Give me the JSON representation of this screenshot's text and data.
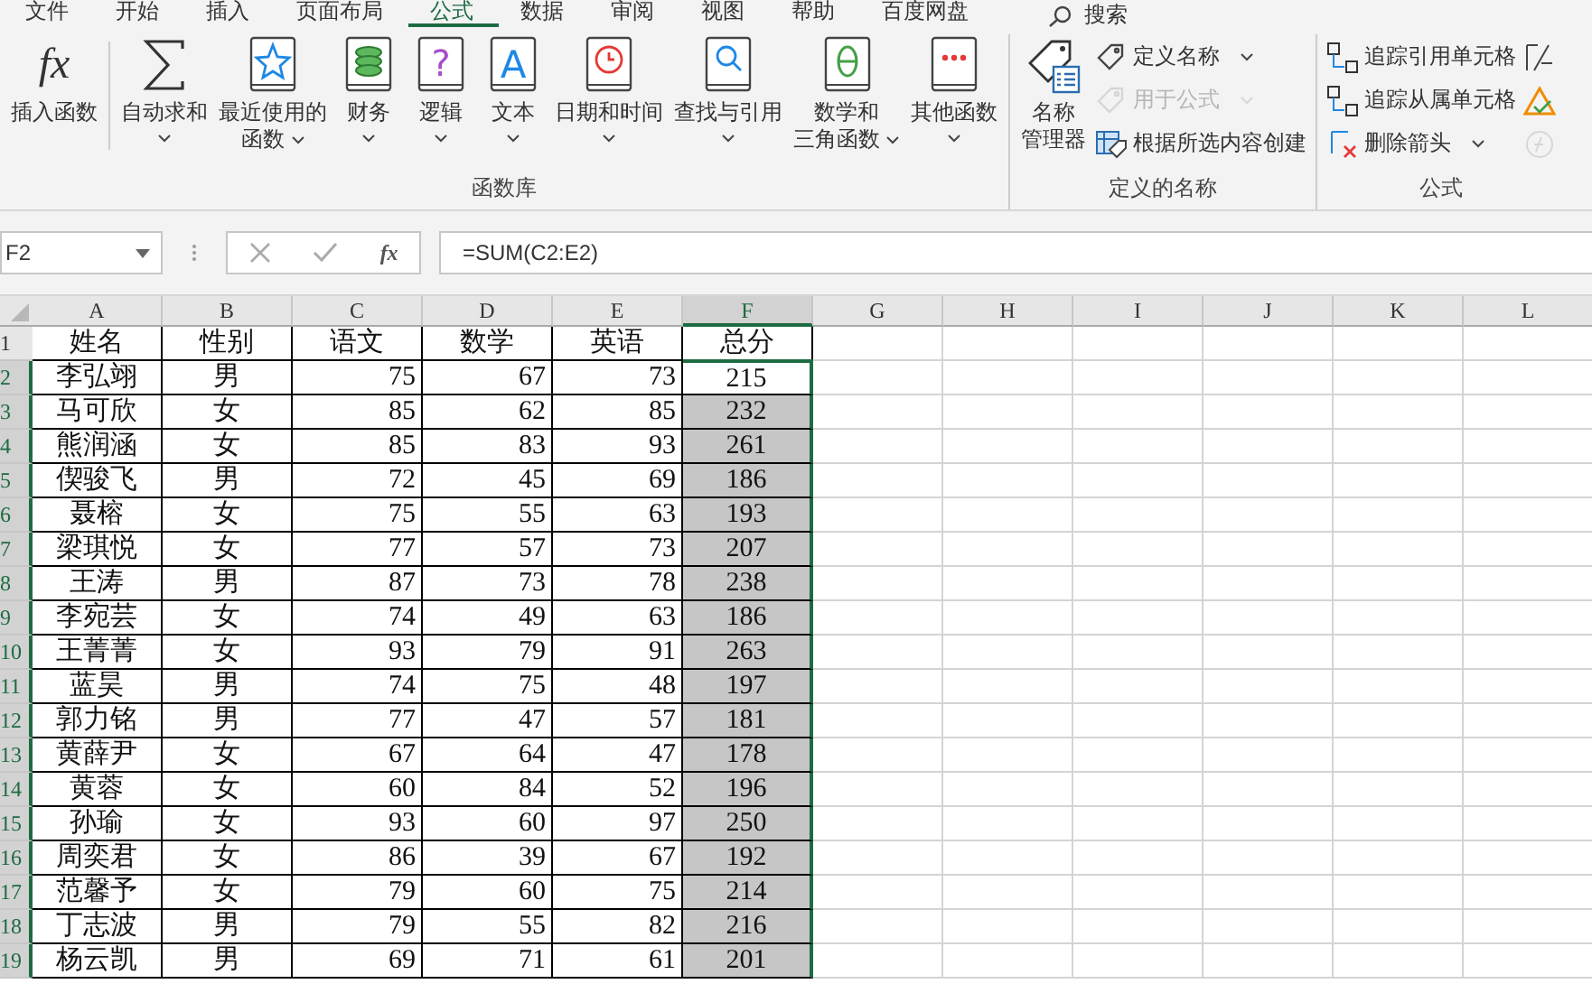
{
  "menu_tabs": [
    {
      "label": "文件",
      "selected": false
    },
    {
      "label": "开始",
      "selected": false
    },
    {
      "label": "插入",
      "selected": false
    },
    {
      "label": "页面布局",
      "selected": false
    },
    {
      "label": "公式",
      "selected": true
    },
    {
      "label": "数据",
      "selected": false
    },
    {
      "label": "审阅",
      "selected": false
    },
    {
      "label": "视图",
      "selected": false
    },
    {
      "label": "帮助",
      "selected": false
    },
    {
      "label": "百度网盘",
      "selected": false
    }
  ],
  "search": {
    "label": "搜索"
  },
  "ribbon": {
    "groups": [
      {
        "label": "函数库",
        "parts": [
          {
            "kind": "big",
            "glyph": "fx",
            "lines": [
              "插入函数"
            ],
            "dropdown": false
          },
          {
            "kind": "big",
            "lines": [
              "自动求和"
            ],
            "dropdown": true
          },
          {
            "kind": "big",
            "lines": [
              "最近使用的",
              "函数"
            ],
            "dropdown": true
          },
          {
            "kind": "big",
            "lines": [
              "财务"
            ],
            "dropdown": true
          },
          {
            "kind": "big",
            "glyph": "?",
            "lines": [
              "逻辑"
            ],
            "dropdown": true
          },
          {
            "kind": "big",
            "glyph": "A",
            "lines": [
              "文本"
            ],
            "dropdown": true
          },
          {
            "kind": "big",
            "lines": [
              "日期和时间"
            ],
            "dropdown": true
          },
          {
            "kind": "big",
            "lines": [
              "查找与引用"
            ],
            "dropdown": true
          },
          {
            "kind": "big",
            "lines": [
              "数学和",
              "三角函数"
            ],
            "dropdown": true
          },
          {
            "kind": "big",
            "lines": [
              "其他函数"
            ],
            "dropdown": true
          }
        ]
      },
      {
        "label": "定义的名称",
        "parts": [
          {
            "kind": "big",
            "lines": [
              "名称",
              "管理器"
            ],
            "dropdown": false
          },
          {
            "kind": "stack",
            "items": [
              {
                "label": "定义名称",
                "dropdown": true,
                "disabled": false
              },
              {
                "label": "用于公式",
                "dropdown": true,
                "disabled": true
              },
              {
                "label": "根据所选内容创建",
                "dropdown": false,
                "disabled": false
              }
            ]
          }
        ]
      },
      {
        "label": "公式",
        "parts": [
          {
            "kind": "stack",
            "items": [
              {
                "label": "追踪引用单元格",
                "dropdown": false,
                "disabled": false
              },
              {
                "label": "追踪从属单元格",
                "dropdown": false,
                "disabled": false
              },
              {
                "label": "删除箭头",
                "dropdown": true,
                "disabled": false
              }
            ]
          },
          {
            "kind": "stack",
            "items": [
              {
                "dropdown": false,
                "disabled": false
              },
              {
                "dropdown": false,
                "disabled": false
              },
              {
                "dropdown": false,
                "disabled": true
              }
            ]
          }
        ]
      }
    ]
  },
  "formula_bar": {
    "name_box": "F2",
    "function_button": "fx",
    "formula": "=SUM(C2:E2)"
  },
  "sheet": {
    "columns": [
      {
        "letter": "A",
        "selected": false
      },
      {
        "letter": "B",
        "selected": false
      },
      {
        "letter": "C",
        "selected": false
      },
      {
        "letter": "D",
        "selected": false
      },
      {
        "letter": "E",
        "selected": false
      },
      {
        "letter": "F",
        "selected": true
      },
      {
        "letter": "G",
        "selected": false
      },
      {
        "letter": "H",
        "selected": false
      },
      {
        "letter": "I",
        "selected": false
      },
      {
        "letter": "J",
        "selected": false
      },
      {
        "letter": "K",
        "selected": false
      },
      {
        "letter": "L",
        "selected": false
      }
    ],
    "rows": [
      {
        "number": "1",
        "selected": false,
        "active": false,
        "cells": [
          "姓名",
          "性别",
          "语文",
          "数学",
          "英语",
          "总分"
        ]
      },
      {
        "number": "2",
        "selected": true,
        "active": true,
        "cells": [
          "李弘翊",
          "男",
          "75",
          "67",
          "73",
          "215"
        ]
      },
      {
        "number": "3",
        "selected": true,
        "active": false,
        "cells": [
          "马可欣",
          "女",
          "85",
          "62",
          "85",
          "232"
        ]
      },
      {
        "number": "4",
        "selected": true,
        "active": false,
        "cells": [
          "熊润涵",
          "女",
          "85",
          "83",
          "93",
          "261"
        ]
      },
      {
        "number": "5",
        "selected": true,
        "active": false,
        "cells": [
          "偰骏飞",
          "男",
          "72",
          "45",
          "69",
          "186"
        ]
      },
      {
        "number": "6",
        "selected": true,
        "active": false,
        "cells": [
          "聂榕",
          "女",
          "75",
          "55",
          "63",
          "193"
        ]
      },
      {
        "number": "7",
        "selected": true,
        "active": false,
        "cells": [
          "梁琪悦",
          "女",
          "77",
          "57",
          "73",
          "207"
        ]
      },
      {
        "number": "8",
        "selected": true,
        "active": false,
        "cells": [
          "王涛",
          "男",
          "87",
          "73",
          "78",
          "238"
        ]
      },
      {
        "number": "9",
        "selected": true,
        "active": false,
        "cells": [
          "李宛芸",
          "女",
          "74",
          "49",
          "63",
          "186"
        ]
      },
      {
        "number": "10",
        "selected": true,
        "active": false,
        "cells": [
          "王菁菁",
          "女",
          "93",
          "79",
          "91",
          "263"
        ]
      },
      {
        "number": "11",
        "selected": true,
        "active": false,
        "cells": [
          "蓝昊",
          "男",
          "74",
          "75",
          "48",
          "197"
        ]
      },
      {
        "number": "12",
        "selected": true,
        "active": false,
        "cells": [
          "郭力铭",
          "男",
          "77",
          "47",
          "57",
          "181"
        ]
      },
      {
        "number": "13",
        "selected": true,
        "active": false,
        "cells": [
          "黄薛尹",
          "女",
          "67",
          "64",
          "47",
          "178"
        ]
      },
      {
        "number": "14",
        "selected": true,
        "active": false,
        "cells": [
          "黄蓉",
          "女",
          "60",
          "84",
          "52",
          "196"
        ]
      },
      {
        "number": "15",
        "selected": true,
        "active": false,
        "cells": [
          "孙瑜",
          "女",
          "93",
          "60",
          "97",
          "250"
        ]
      },
      {
        "number": "16",
        "selected": true,
        "active": false,
        "cells": [
          "周奕君",
          "女",
          "86",
          "39",
          "67",
          "192"
        ]
      },
      {
        "number": "17",
        "selected": true,
        "active": false,
        "cells": [
          "范馨予",
          "女",
          "79",
          "60",
          "75",
          "214"
        ]
      },
      {
        "number": "18",
        "selected": true,
        "active": false,
        "cells": [
          "丁志波",
          "男",
          "79",
          "55",
          "82",
          "216"
        ]
      },
      {
        "number": "19",
        "selected": true,
        "active": false,
        "cells": [
          "杨云凯",
          "男",
          "69",
          "71",
          "61",
          "201"
        ]
      }
    ]
  }
}
